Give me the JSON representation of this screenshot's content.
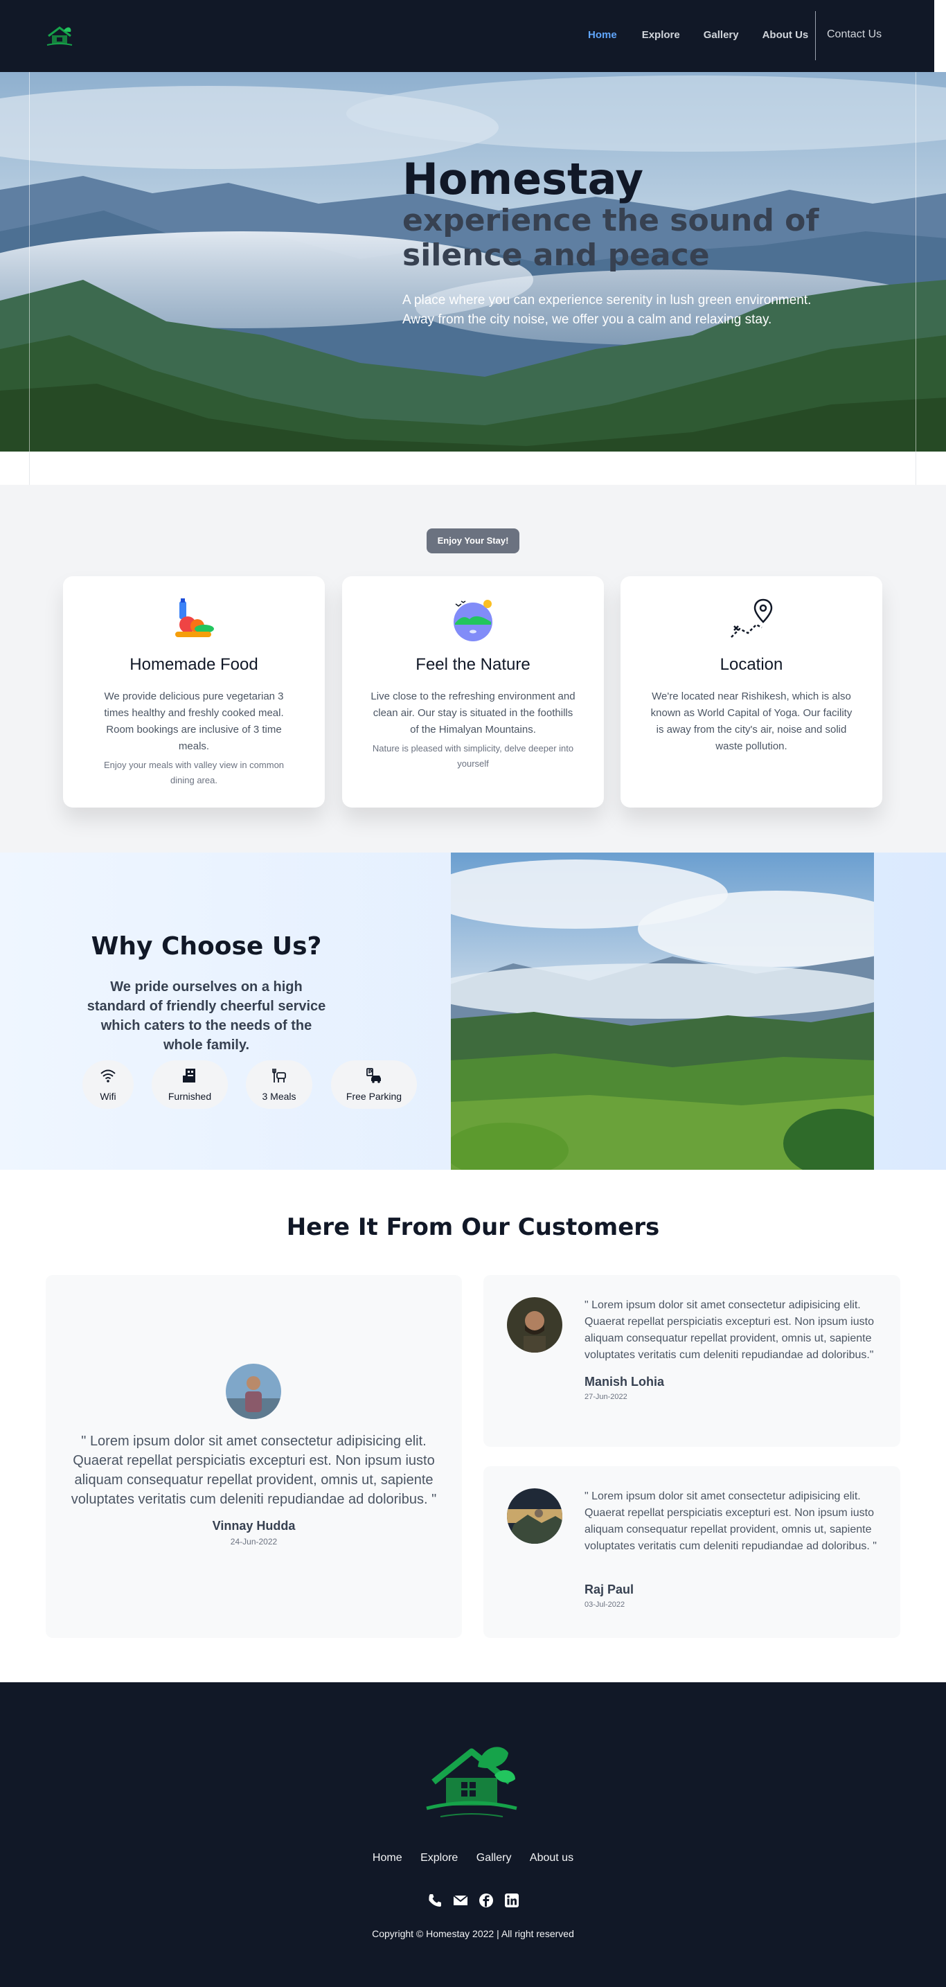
{
  "nav": {
    "links": [
      "Home",
      "Explore",
      "Gallery",
      "About Us"
    ],
    "active": "Home",
    "contact": "Contact Us"
  },
  "hero": {
    "title": "Homestay",
    "subtitle": "experience the sound of silence and peace",
    "description_line1": "A place where you can experience serenity in lush green environment.",
    "description_line2": "Away from the city noise, we offer you a calm and relaxing stay."
  },
  "features": {
    "badge": "Enjoy Your Stay!",
    "cards": [
      {
        "icon": "food-icon",
        "title": "Homemade Food",
        "text": "We provide delicious pure vegetarian 3 times healthy and freshly cooked meal. Room bookings are inclusive of 3 time meals.",
        "note": "Enjoy your meals with valley view in common dining area."
      },
      {
        "icon": "nature-icon",
        "title": "Feel the Nature",
        "text": "Live close to the refreshing environment and clean air. Our stay is situated in the foothills of the Himalyan Mountains.",
        "note": "Nature is pleased with simplicity, delve deeper into yourself"
      },
      {
        "icon": "location-map-icon",
        "title": "Location",
        "text": "We're located near Rishikesh, which is also known as World Capital of Yoga. Our facility is away from the city's air, noise and solid waste pollution.",
        "note": ""
      }
    ]
  },
  "why": {
    "title": "Why Choose Us?",
    "text": "We pride ourselves on a high standard of friendly cheerful service which caters to the needs of the whole family.",
    "amenities": [
      {
        "label": "Wifi",
        "icon": "wifi-icon"
      },
      {
        "label": "Furnished",
        "icon": "furniture-icon"
      },
      {
        "label": "3 Meals",
        "icon": "meals-icon"
      },
      {
        "label": "Free Parking",
        "icon": "parking-icon"
      }
    ]
  },
  "testimonials": {
    "title": "Here It From Our Customers",
    "items": [
      {
        "quote": "\" Lorem ipsum dolor sit amet consectetur adipisicing elit. Quaerat repellat perspiciatis excepturi est. Non ipsum iusto aliquam consequatur repellat provident, omnis ut, sapiente voluptates veritatis cum deleniti repudiandae ad doloribus. \"",
        "name": "Vinnay Hudda",
        "date": "24-Jun-2022"
      },
      {
        "quote": "\" Lorem ipsum dolor sit amet consectetur adipisicing elit. Quaerat repellat perspiciatis excepturi est. Non ipsum iusto aliquam consequatur repellat provident, omnis ut, sapiente voluptates veritatis cum deleniti repudiandae ad doloribus.\"",
        "name": "Manish Lohia",
        "date": "27-Jun-2022"
      },
      {
        "quote": "\" Lorem ipsum dolor sit amet consectetur adipisicing elit. Quaerat repellat perspiciatis excepturi est. Non ipsum iusto aliquam consequatur repellat provident, omnis ut, sapiente voluptates veritatis cum deleniti repudiandae ad doloribus. \"",
        "name": "Raj Paul",
        "date": "03-Jul-2022"
      }
    ]
  },
  "footer": {
    "links": [
      "Home",
      "Explore",
      "Gallery",
      "About us"
    ],
    "social": [
      "phone-icon",
      "mail-icon",
      "facebook-icon",
      "linkedin-icon"
    ],
    "copyright": "Copyright © Homestay 2022 | All right reserved"
  },
  "colors": {
    "nav_bg": "#111827",
    "active_link": "#60a5fa",
    "brand_green": "#16a34a",
    "footer_bg": "#111827"
  }
}
